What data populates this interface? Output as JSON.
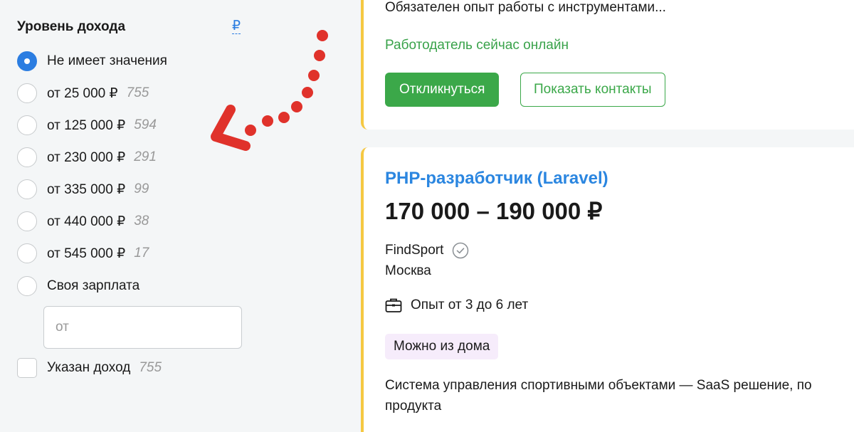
{
  "filter": {
    "title": "Уровень дохода",
    "currency": "₽",
    "options": [
      {
        "label": "Не имеет значения",
        "count": "",
        "checked": true
      },
      {
        "label": "от 25 000 ₽",
        "count": "755",
        "checked": false
      },
      {
        "label": "от 125 000 ₽",
        "count": "594",
        "checked": false
      },
      {
        "label": "от 230 000 ₽",
        "count": "291",
        "checked": false
      },
      {
        "label": "от 335 000 ₽",
        "count": "99",
        "checked": false
      },
      {
        "label": "от 440 000 ₽",
        "count": "38",
        "checked": false
      },
      {
        "label": "от 545 000 ₽",
        "count": "17",
        "checked": false
      },
      {
        "label": "Своя зарплата",
        "count": "",
        "checked": false
      }
    ],
    "custom_salary_placeholder": "от",
    "salary_specified": {
      "label": "Указан доход",
      "count": "755",
      "checked": false
    }
  },
  "prev_card": {
    "snippet": "Обязателен опыт работы с инструментами...",
    "online_status": "Работодатель сейчас онлайн",
    "respond_label": "Откликнуться",
    "contacts_label": "Показать контакты"
  },
  "vacancy": {
    "title": "PHP-разработчик (Laravel)",
    "salary": "170 000 – 190 000 ₽",
    "company": "FindSport",
    "city": "Москва",
    "experience": "Опыт от 3 до 6 лет",
    "remote_badge": "Можно из дома",
    "description": "Система управления спортивными объектами — SaaS решение, по",
    "description_line2": "продукта"
  },
  "icons": {
    "verified": "check-circle-icon",
    "briefcase": "briefcase-icon"
  },
  "colors": {
    "accent_blue": "#2b7de1",
    "green": "#3ba849",
    "card_border": "#f5c842",
    "annotation_red": "#e0322b",
    "badge_bg": "#f6ecfb"
  }
}
